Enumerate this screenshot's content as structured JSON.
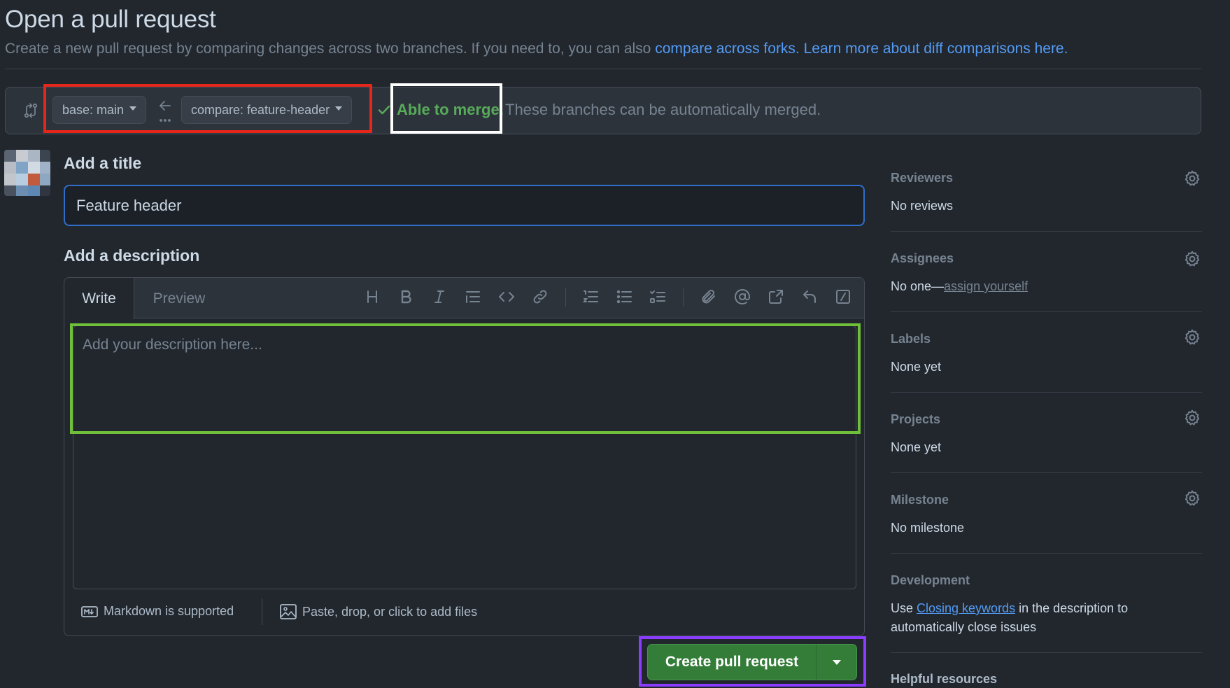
{
  "page": {
    "title": "Open a pull request",
    "subtitle_text": "Create a new pull request by comparing changes across two branches. If you need to, you can also ",
    "subtitle_link_forks": "compare across forks.",
    "subtitle_link_learn": "Learn more about diff comparisons here."
  },
  "compare": {
    "base_label": "base: main",
    "compare_label": "compare: feature-header",
    "merge_status": "Able to merge.",
    "merge_message": "These branches can be automatically merged."
  },
  "form": {
    "title_label": "Add a title",
    "title_value": "Feature header",
    "description_label": "Add a description",
    "tabs": [
      "Write",
      "Preview"
    ],
    "description_placeholder": "Add your description here...",
    "markdown_note": "Markdown is supported",
    "files_note": "Paste, drop, or click to add files",
    "submit_label": "Create pull request"
  },
  "toolbar_icons": [
    "heading-icon",
    "bold-icon",
    "italic-icon",
    "quote-icon",
    "code-icon",
    "link-icon",
    "ordered-list-icon",
    "unordered-list-icon",
    "task-list-icon",
    "attach-icon",
    "mention-icon",
    "reference-icon",
    "reply-icon",
    "slash-command-icon"
  ],
  "sidebar": {
    "reviewers": {
      "heading": "Reviewers",
      "value": "No reviews"
    },
    "assignees": {
      "heading": "Assignees",
      "value_prefix": "No one—",
      "value_link": "assign yourself"
    },
    "labels": {
      "heading": "Labels",
      "value": "None yet"
    },
    "projects": {
      "heading": "Projects",
      "value": "None yet"
    },
    "milestone": {
      "heading": "Milestone",
      "value": "No milestone"
    },
    "development": {
      "heading": "Development",
      "value_prefix": "Use ",
      "value_link": "Closing keywords",
      "value_suffix": " in the description to automatically close issues"
    },
    "helpful": {
      "heading": "Helpful resources"
    }
  },
  "colors": {
    "background": "#22272e",
    "accent_link": "#539bf5",
    "success": "#57ab5a",
    "button_green": "#347d39",
    "highlight_red": "#e5261a",
    "highlight_white": "#ffffff",
    "highlight_green": "#6fbf3a",
    "highlight_purple": "#8a3dff"
  }
}
